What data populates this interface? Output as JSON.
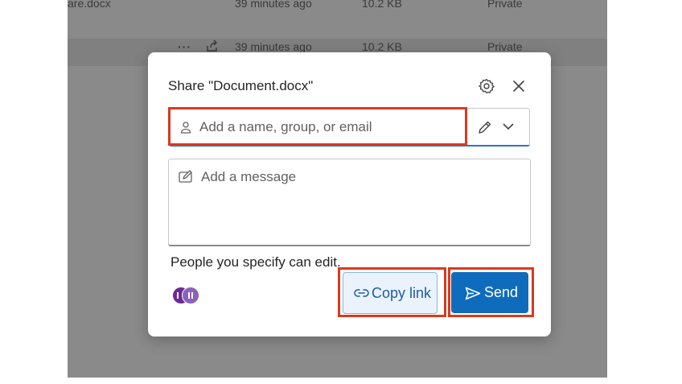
{
  "file_list": {
    "rows": [
      {
        "name": "are.docx",
        "modified": "39 minutes ago",
        "size": "10.2 KB",
        "sharing": "Private"
      },
      {
        "name": "",
        "modified": "39 minutes ago",
        "size": "10.2 KB",
        "sharing": "Private",
        "more_label": "···"
      }
    ]
  },
  "dialog": {
    "title": "Share \"Document.docx\"",
    "recipient_placeholder": "Add a name, group, or email",
    "message_placeholder": "Add a message",
    "permission_text": "People you specify can edit.",
    "copy_link_label": "Copy link",
    "send_label": "Send"
  },
  "icons": {
    "settings": "gear-icon",
    "close": "close-icon",
    "recipient": "person-icon",
    "permission": "pencil-icon",
    "dropdown": "chevron-down-icon",
    "message": "compose-icon",
    "copy_link": "link-icon",
    "send": "send-icon",
    "row_share": "share-icon"
  },
  "colors": {
    "accent": "#0f6cbd",
    "highlight": "#d93a1e",
    "copy_link_bg": "#eaf3fc",
    "avatar_primary": "#6a2c91",
    "avatar_secondary": "#8a62b8"
  }
}
